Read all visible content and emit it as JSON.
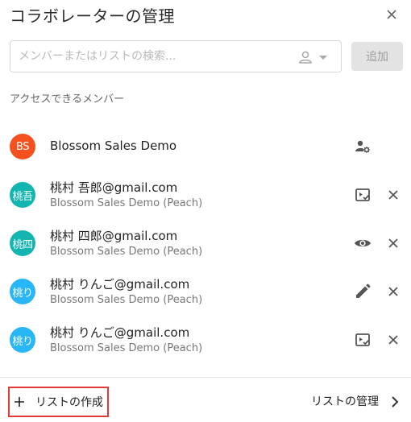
{
  "dialog": {
    "title": "コラボレーターの管理",
    "search_placeholder": "メンバーまたはリストの検索...",
    "add_label": "追加",
    "section_label": "アクセスできるメンバー"
  },
  "members": [
    {
      "initials": "BS",
      "avatar_color": "#f4511e",
      "name": "Blossom Sales Demo",
      "subtitle": "",
      "role_icon": "manage-accounts-icon"
    },
    {
      "initials": "桃吾",
      "avatar_color": "#12b5b0",
      "name": "桃村 吾郎@gmail.com",
      "subtitle": "Blossom Sales Demo (Peach)",
      "role_icon": "slideshow-check-icon"
    },
    {
      "initials": "桃四",
      "avatar_color": "#12b5b0",
      "name": "桃村 四郎@gmail.com",
      "subtitle": "Blossom Sales Demo (Peach)",
      "role_icon": "eye-icon"
    },
    {
      "initials": "桃り",
      "avatar_color": "#29b6f6",
      "name": "桃村 りんご@gmail.com",
      "subtitle": "Blossom Sales Demo (Peach)",
      "role_icon": "pencil-icon"
    },
    {
      "initials": "桃り",
      "avatar_color": "#29b6f6",
      "name": "桃村 りんご@gmail.com",
      "subtitle": "Blossom Sales Demo (Peach)",
      "role_icon": "slideshow-check-icon"
    }
  ],
  "footer": {
    "create_list_label": "リストの作成",
    "manage_lists_label": "リストの管理"
  }
}
